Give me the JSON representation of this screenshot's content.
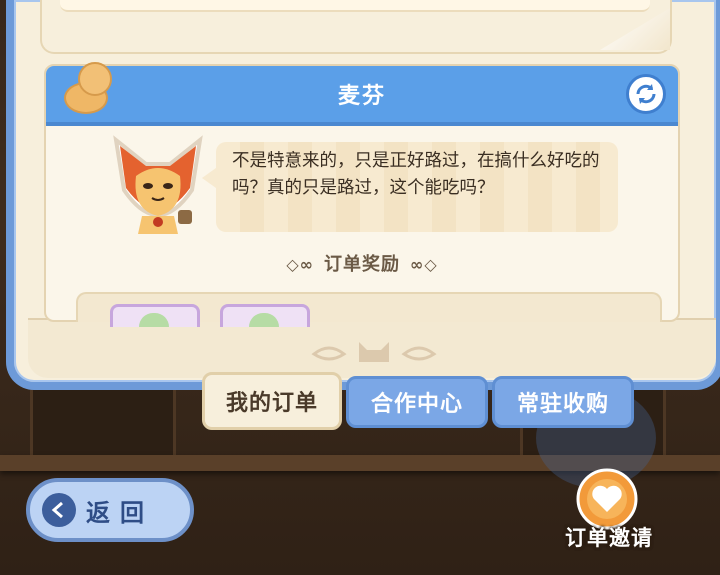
{
  "card": {
    "customer_name": "麦芬",
    "dialogue": "不是特意来的，只是正好路过，在搞什么好吃的吗？真的只是路过，这个能吃吗？",
    "reward_title": "订单奖励"
  },
  "tabs": [
    {
      "label": "我的订单",
      "active": true
    },
    {
      "label": "合作中心",
      "active": false
    },
    {
      "label": "常驻收购",
      "active": false
    }
  ],
  "back_button": {
    "label": "返回"
  },
  "invite": {
    "label": "订单邀请"
  },
  "colors": {
    "header_blue": "#5b9fe8",
    "frame_blue": "#6d9ad8",
    "paper": "#f7efdc",
    "invite_orange": "#f29a3a"
  },
  "icons": {
    "refresh": "refresh-icon",
    "pin": "pushpin-icon",
    "back": "back-arrow-icon",
    "invite": "order-invite-icon"
  }
}
